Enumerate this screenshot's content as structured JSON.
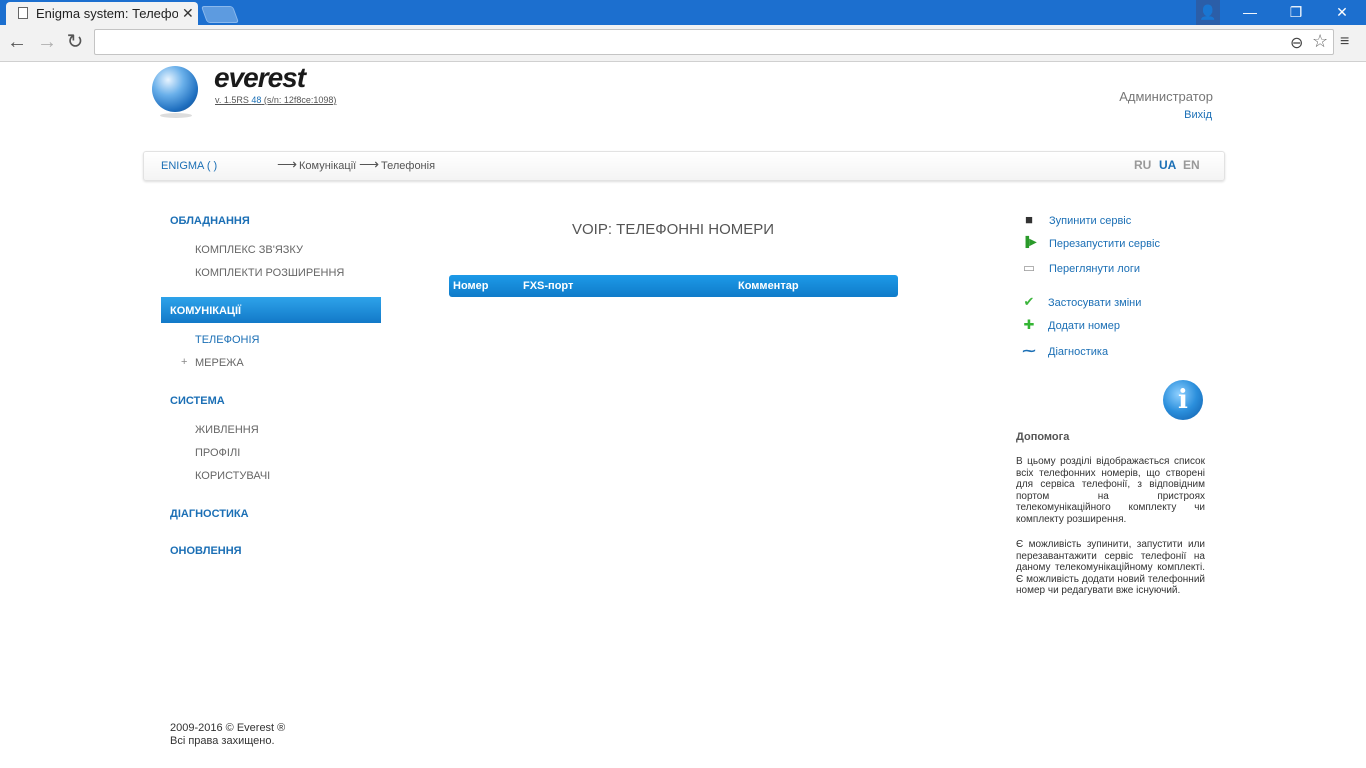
{
  "browser": {
    "tab_title": "Enigma system: Телефонія",
    "tab_close": "✕",
    "win_user": "👤",
    "win_min": "—",
    "win_max": "❐",
    "win_close": "✕",
    "nav_back": "←",
    "nav_forward": "→",
    "nav_reload": "↻",
    "zoom_icon": "⊖",
    "star_icon": "☆",
    "menu_icon": "≡"
  },
  "header": {
    "brand": "everest",
    "version_prefix": "v. 1.5RS ",
    "version_build": "48",
    "version_serial": " (s/n: 12f8ce:1098)",
    "user_name": "Администратор",
    "logout": "Вихід"
  },
  "breadcrumb": {
    "root": "ENIGMA (                  )",
    "arrow": "⟶",
    "items": [
      "Комунікації",
      "Телефонія"
    ],
    "languages": [
      "RU",
      "UA",
      "EN"
    ],
    "active_language": "UA"
  },
  "sidebar": {
    "sections": [
      {
        "label": "ОБЛАДНАННЯ",
        "items": [
          "КОМПЛЕКС ЗВ'ЯЗКУ",
          "КОМПЛЕКТИ РОЗШИРЕННЯ"
        ]
      },
      {
        "label": "КОМУНІКАЦІЇ",
        "active": true,
        "items": [
          "ТЕЛЕФОНІЯ",
          "МЕРЕЖА"
        ]
      },
      {
        "label": "СИСТЕМА",
        "items": [
          "ЖИВЛЕННЯ",
          "ПРОФІЛІ",
          "КОРИСТУВАЧІ"
        ]
      },
      {
        "label": "ДІАГНОСТИКА",
        "items": []
      },
      {
        "label": "ОНОВЛЕННЯ",
        "items": []
      }
    ],
    "expand_symbol": "+"
  },
  "main": {
    "title": "VOIP: ТЕЛЕФОННІ НОМЕРИ",
    "columns": [
      "Номер",
      "FXS-порт",
      "Комментар"
    ],
    "rows": []
  },
  "actions": [
    {
      "label": "Зупинити сервіс",
      "icon": "stop-icon",
      "glyph": "■",
      "color": "#333333"
    },
    {
      "label": "Перезапустити сервіс",
      "icon": "restart-icon",
      "glyph": "▐▶",
      "color": "#2a9a2a"
    },
    {
      "label": "Переглянути логи",
      "icon": "clipboard-icon",
      "glyph": "▭",
      "color": "#999999"
    },
    {
      "label": "Застосувати зміни",
      "icon": "checkmark-icon",
      "glyph": "✔",
      "color": "#3cb53c"
    },
    {
      "label": "Додати номер",
      "icon": "plus-icon",
      "glyph": "✚",
      "color": "#33b533"
    },
    {
      "label": "Діагностика",
      "icon": "pulse-icon",
      "glyph": "⁓",
      "color": "#1b6fb5"
    }
  ],
  "help": {
    "title": "Допомога",
    "info_glyph": "i",
    "paragraph1": "В цьому розділі відображається список всіх телефонних номерів, що створені для сервіса телефонії, з відповідним портом на пристроях телекомунікаційного комплекту чи комплекту розширення.",
    "paragraph2": "Є можливість зупинити, запустити или перезавантажити сервіс телефонії на даному телекомунікаційному комплекті. Є можливість додати новий телефонний номер чи редагувати вже існуючий."
  },
  "footer": {
    "line1": "2009-2016 © Everest ®",
    "line2": "Всі права захищено."
  }
}
